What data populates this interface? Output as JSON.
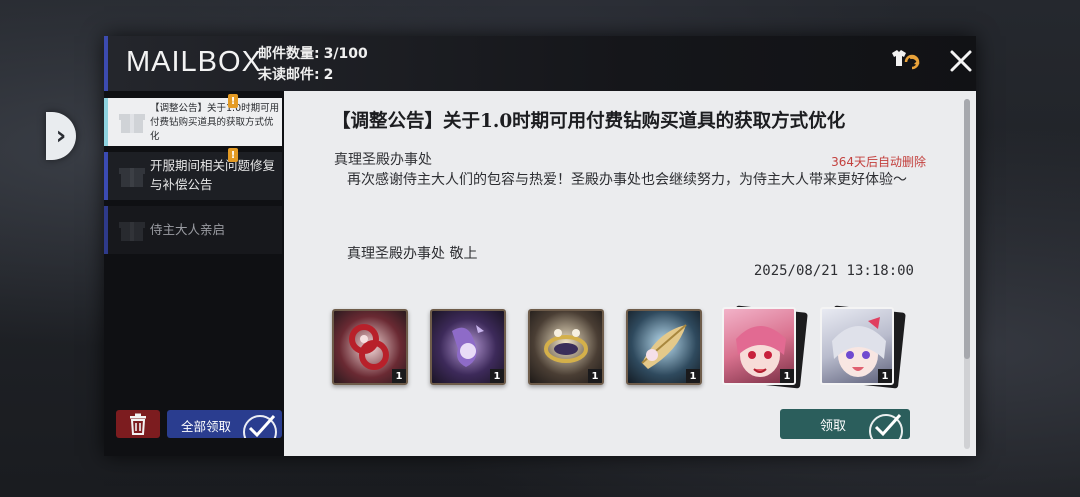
{
  "header": {
    "title": "MAILBOX",
    "mail_count_label": "邮件数量:",
    "mail_count_value": "3/100",
    "unread_label": "未读邮件:",
    "unread_value": "2"
  },
  "sidebar": {
    "items": [
      {
        "label": "【调整公告】关于1.0时期可用付费钻购买道具的获取方式优化",
        "badge": "!",
        "state": "active"
      },
      {
        "label": "开服期间相关问题修复与补偿公告",
        "badge": "!",
        "state": "unread"
      },
      {
        "label": "侍主大人亲启",
        "badge": "",
        "state": "read"
      }
    ],
    "claim_all_label": "全部领取"
  },
  "mail": {
    "title": "【调整公告】关于1.0时期可用付费钻购买道具的获取方式优化",
    "sender": "真理圣殿办事处",
    "expire": "364天后自动删除",
    "body": "再次感谢侍主大人们的包容与热爱！圣殿办事处也会继续努力，为侍主大人带来更好体验～",
    "signature": "真理圣殿办事处 敬上",
    "date": "2025/08/21 13:18:00",
    "claim_label": "领取",
    "attachments": [
      {
        "type": "item",
        "icon": "red-ring-item-icon",
        "qty": "1"
      },
      {
        "type": "item",
        "icon": "purple-flower-item-icon",
        "qty": "1"
      },
      {
        "type": "item",
        "icon": "gold-ring-item-icon",
        "qty": "1"
      },
      {
        "type": "item",
        "icon": "feather-scroll-item-icon",
        "qty": "1"
      },
      {
        "type": "card",
        "icon": "pink-hair-character-card",
        "qty": "1"
      },
      {
        "type": "card",
        "icon": "silver-hair-character-card",
        "qty": "1"
      }
    ]
  },
  "colors": {
    "accent_blue": "#3b4bb3",
    "delete_red": "#7c1c1f",
    "claim_teal": "#2b5e5c",
    "expire_red": "#c3403d",
    "badge_orange": "#e49b24"
  }
}
